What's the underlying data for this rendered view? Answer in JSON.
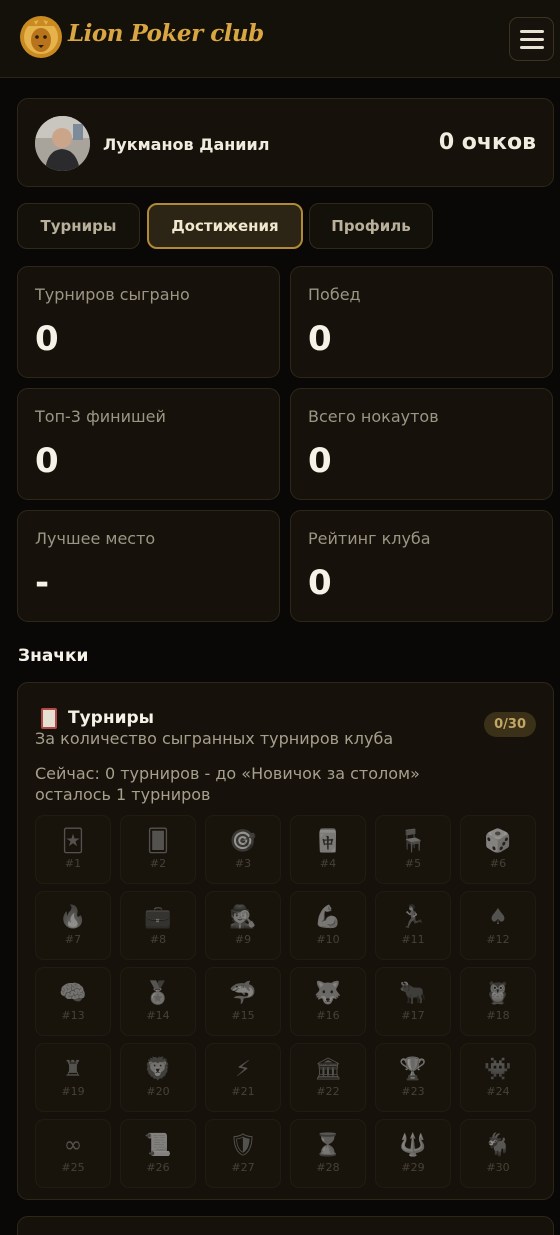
{
  "header": {
    "brand": "Lion Poker club",
    "logo_icon": "lion-logo-icon",
    "menu_icon": "hamburger-menu-icon"
  },
  "user": {
    "name": "Лукманов Даниил",
    "points": "0 очков",
    "avatar_icon": "user-avatar-photo"
  },
  "tabs": [
    {
      "label": "Турниры",
      "active": false
    },
    {
      "label": "Достижения",
      "active": true
    },
    {
      "label": "Профиль",
      "active": false
    }
  ],
  "stats": [
    {
      "label": "Турниров сыграно",
      "value": "0"
    },
    {
      "label": "Побед",
      "value": "0"
    },
    {
      "label": "Топ-3 финишей",
      "value": "0"
    },
    {
      "label": "Всего нокаутов",
      "value": "0"
    },
    {
      "label": "Лучшее место",
      "value": "-"
    },
    {
      "label": "Рейтинг клуба",
      "value": "0"
    }
  ],
  "badges_section": {
    "title": "Значки",
    "card": {
      "icon": "playing-card-icon",
      "title": "Турниры",
      "subtitle": "За количество сыгранных турниров клуба",
      "count": "0/30",
      "progress": "Сейчас: 0 турниров - до «Новичок за столом» осталось 1 турниров",
      "badges": [
        {
          "num": "#1",
          "glyph": "🃏",
          "icon": "joker-card-icon"
        },
        {
          "num": "#2",
          "glyph": "🂠",
          "icon": "card-back-icon"
        },
        {
          "num": "#3",
          "glyph": "🎯",
          "icon": "target-icon"
        },
        {
          "num": "#4",
          "glyph": "🀄",
          "icon": "mahjong-tile-icon"
        },
        {
          "num": "#5",
          "glyph": "🪑",
          "icon": "chair-icon"
        },
        {
          "num": "#6",
          "glyph": "🎲",
          "icon": "dice-icon"
        },
        {
          "num": "#7",
          "glyph": "🔥",
          "icon": "fire-icon"
        },
        {
          "num": "#8",
          "glyph": "💼",
          "icon": "briefcase-icon"
        },
        {
          "num": "#9",
          "glyph": "🕵",
          "icon": "detective-icon"
        },
        {
          "num": "#10",
          "glyph": "💪",
          "icon": "flexed-arm-icon"
        },
        {
          "num": "#11",
          "glyph": "🏃",
          "icon": "runner-icon"
        },
        {
          "num": "#12",
          "glyph": "♠",
          "icon": "spade-icon"
        },
        {
          "num": "#13",
          "glyph": "🧠",
          "icon": "brain-icon"
        },
        {
          "num": "#14",
          "glyph": "🏅",
          "icon": "medal-icon"
        },
        {
          "num": "#15",
          "glyph": "🦈",
          "icon": "shark-icon"
        },
        {
          "num": "#16",
          "glyph": "🐺",
          "icon": "wolf-icon"
        },
        {
          "num": "#17",
          "glyph": "🐂",
          "icon": "bull-icon"
        },
        {
          "num": "#18",
          "glyph": "🦉",
          "icon": "owl-icon"
        },
        {
          "num": "#19",
          "glyph": "♜",
          "icon": "castle-rook-icon"
        },
        {
          "num": "#20",
          "glyph": "🦁",
          "icon": "lion-icon"
        },
        {
          "num": "#21",
          "glyph": "⚡",
          "icon": "lightning-icon"
        },
        {
          "num": "#22",
          "glyph": "🏛",
          "icon": "classical-building-icon"
        },
        {
          "num": "#23",
          "glyph": "🏆",
          "icon": "trophy-icon"
        },
        {
          "num": "#24",
          "glyph": "👾",
          "icon": "monster-icon"
        },
        {
          "num": "#25",
          "glyph": "∞",
          "icon": "infinity-icon"
        },
        {
          "num": "#26",
          "glyph": "📜",
          "icon": "scroll-icon"
        },
        {
          "num": "#27",
          "glyph": "🛡",
          "icon": "shield-icon"
        },
        {
          "num": "#28",
          "glyph": "⌛",
          "icon": "hourglass-icon"
        },
        {
          "num": "#29",
          "glyph": "🔱",
          "icon": "trident-icon"
        },
        {
          "num": "#30",
          "glyph": "🐐",
          "icon": "goat-icon"
        }
      ]
    }
  },
  "colors": {
    "background": "#090806",
    "card": "#16120b",
    "accent_gold": "#d9a641",
    "active_tab_border": "#b08a36",
    "muted_text": "#9b9584"
  }
}
